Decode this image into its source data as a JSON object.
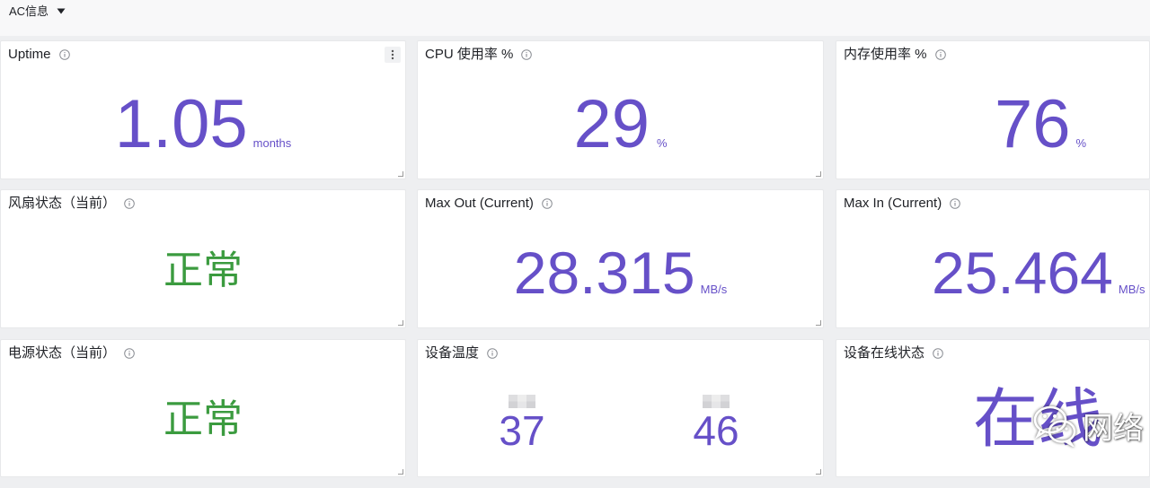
{
  "header": {
    "row_title": "AC信息",
    "caret_icon": "caret-down-icon"
  },
  "colors": {
    "value": "#6650c8",
    "status_ok": "#3b9b3f",
    "title_text": "#202227"
  },
  "icons": {
    "info": "info-icon",
    "panel_menu": "kebab-menu-icon",
    "resize": "resize-handle-icon"
  },
  "panels": [
    {
      "title": "Uptime",
      "value": "1.05",
      "unit": "months"
    },
    {
      "title": "CPU 使用率 %",
      "value": "29",
      "unit": "%"
    },
    {
      "title": "内存使用率 %",
      "value": "76",
      "unit": "%"
    },
    {
      "title": "风扇状态（当前）",
      "value": "正常"
    },
    {
      "title": "Max Out (Current)",
      "value": "28.315",
      "unit": "MB/s"
    },
    {
      "title": "Max In (Current)",
      "value": "25.464",
      "unit": "MB/s"
    },
    {
      "title": "电源状态（当前）",
      "value": "正常"
    },
    {
      "title": "设备温度",
      "values": [
        "37",
        "46"
      ]
    },
    {
      "title": "设备在线状态",
      "value": "在线"
    }
  ],
  "watermark": {
    "text": "网络",
    "icon": "wechat-icon"
  }
}
